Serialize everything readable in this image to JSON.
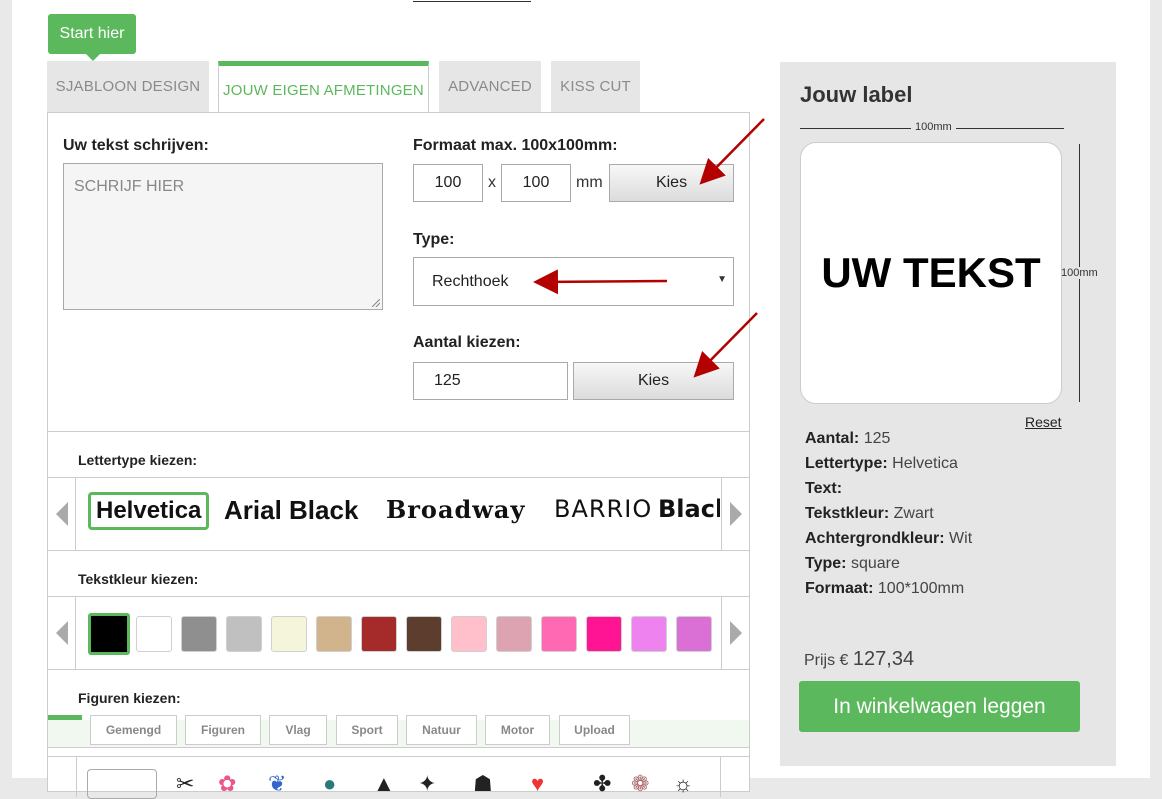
{
  "start_label": "Start hier",
  "tabs": [
    {
      "label": "SJABLOON DESIGN"
    },
    {
      "label": "JOUW EIGEN AFMETINGEN"
    },
    {
      "label": "ADVANCED"
    },
    {
      "label": "KISS CUT"
    }
  ],
  "text": {
    "label": "Uw tekst schrijven:",
    "placeholder": "SCHRIJF HIER"
  },
  "format": {
    "label": "Formaat max. 100x100mm:",
    "width": "100",
    "separator": "x",
    "height": "100",
    "unit": "mm",
    "button": "Kies"
  },
  "type": {
    "label": "Type:",
    "selected": "Rechthoek"
  },
  "quantity": {
    "label": "Aantal kiezen:",
    "value": "125",
    "button": "Kies"
  },
  "font_section": {
    "label": "Lettertype kiezen:",
    "fonts": [
      "Helvetica",
      "Arial Black",
      "Broadway",
      "BARRIO",
      "Black"
    ]
  },
  "color_section": {
    "label": "Tekstkleur kiezen:",
    "colors": [
      "#000000",
      "#ffffff",
      "#8f8f8f",
      "#c0c0c0",
      "#f5f5dc",
      "#d2b48c",
      "#a52a2a",
      "#5c3d2e",
      "#ffc0cb",
      "#dda3b0",
      "#ff69b4",
      "#ff1493",
      "#ee82ee",
      "#da70d6",
      "#ff00ff"
    ]
  },
  "figures_section": {
    "label": "Figuren kiezen:",
    "tabs": [
      "Gemengd",
      "Figuren",
      "Vlag",
      "Sport",
      "Natuur",
      "Motor",
      "Upload"
    ]
  },
  "preview": {
    "title": "Jouw label",
    "width_label": "100mm",
    "height_label": "100mm",
    "text": "UW TEKST",
    "reset": "Reset"
  },
  "summary": [
    {
      "key": "Aantal:",
      "value": "125"
    },
    {
      "key": "Lettertype:",
      "value": "Helvetica"
    },
    {
      "key": "Text:",
      "value": ""
    },
    {
      "key": "Tekstkleur:",
      "value": "Zwart"
    },
    {
      "key": "Achtergrondkleur:",
      "value": "Wit"
    },
    {
      "key": "Type:",
      "value": "square"
    },
    {
      "key": "Formaat:",
      "value": "100*100mm"
    }
  ],
  "price": {
    "label": "Prijs €",
    "value": "127,34"
  },
  "cart_button": "In winkelwagen leggen",
  "accent_color": "#5cb85c",
  "annotation_arrow_color": "#b30000"
}
